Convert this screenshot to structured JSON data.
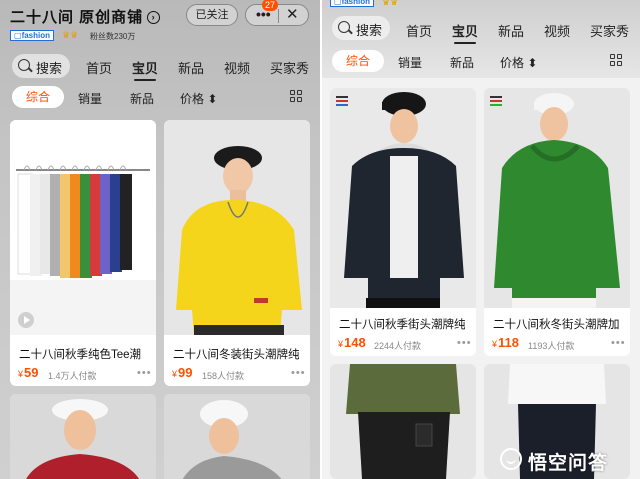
{
  "left": {
    "shop_title": "二十八间 原创商铺",
    "follow_label": "已关注",
    "more_label": "•••",
    "close_label": "✕",
    "badge_count": "27",
    "brand_tag": "fashion",
    "fans": "粉丝数230万",
    "search_label": "搜索",
    "nav_tabs": [
      "首页",
      "宝贝",
      "新品",
      "视频",
      "买家秀"
    ],
    "active_tab": "宝贝",
    "sort": [
      "综合",
      "销量",
      "新品",
      "价格"
    ],
    "products": [
      {
        "title": "二十八间秋季纯色Tee潮",
        "price": "59",
        "sold": "1.4万人付款"
      },
      {
        "title": "二十八间冬装街头潮牌纯",
        "price": "99",
        "sold": "158人付款"
      }
    ]
  },
  "right": {
    "brand_tag": "fashion",
    "search_label": "搜索",
    "nav_tabs": [
      "首页",
      "宝贝",
      "新品",
      "视频",
      "买家秀"
    ],
    "active_tab": "宝贝",
    "sort": [
      "综合",
      "销量",
      "新品",
      "价格"
    ],
    "products": [
      {
        "title": "二十八间秋季街头潮牌纯",
        "price": "148",
        "sold": "2244人付款"
      },
      {
        "title": "二十八间秋冬街头潮牌加",
        "price": "118",
        "sold": "1193人付款"
      }
    ]
  },
  "currency": "¥",
  "watermark": "悟空问答",
  "colors": {
    "accent": "#ff5000",
    "brand_blue": "#1f6fd6"
  }
}
